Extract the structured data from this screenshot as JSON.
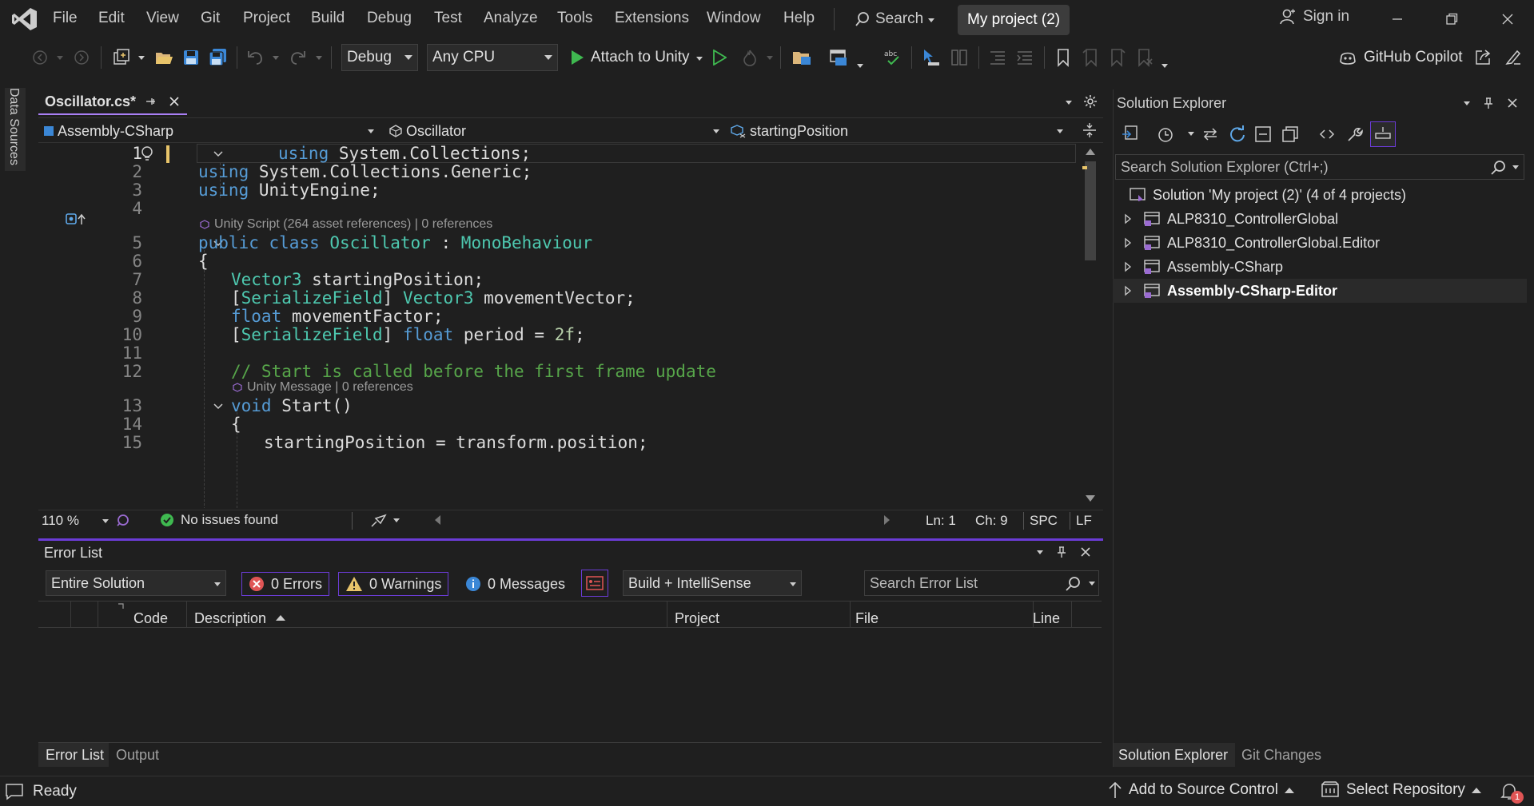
{
  "menu": {
    "items": [
      "File",
      "Edit",
      "View",
      "Git",
      "Project",
      "Build",
      "Debug",
      "Test",
      "Analyze",
      "Tools",
      "Extensions",
      "Window",
      "Help"
    ],
    "search_label": "Search",
    "project_name": "My project (2)",
    "sign_in": "Sign in"
  },
  "toolbar": {
    "config": "Debug",
    "platform": "Any CPU",
    "attach_label": "Attach to Unity",
    "copilot_label": "GitHub Copilot"
  },
  "left_strip": {
    "data_sources": "Data Sources"
  },
  "editor": {
    "tab_label": "Oscillator.cs*",
    "nav": {
      "project": "Assembly-CSharp",
      "type": "Oscillator",
      "member": "startingPosition"
    },
    "lines": [
      {
        "num": "1",
        "text": "using System.Collections;"
      },
      {
        "num": "2",
        "text": "using System.Collections.Generic;"
      },
      {
        "num": "3",
        "text": "using UnityEngine;"
      },
      {
        "num": "4",
        "text": ""
      },
      {
        "num": "5",
        "text": "public class Oscillator : MonoBehaviour"
      },
      {
        "num": "6",
        "text": "{"
      },
      {
        "num": "7",
        "text": "Vector3 startingPosition;"
      },
      {
        "num": "8",
        "text": "[SerializeField] Vector3 movementVector;"
      },
      {
        "num": "9",
        "text": "float movementFactor;"
      },
      {
        "num": "10",
        "text": "[SerializeField] float period = 2f;"
      },
      {
        "num": "11",
        "text": ""
      },
      {
        "num": "12",
        "text": "// Start is called before the first frame update"
      },
      {
        "num": "13",
        "text": "void Start()"
      },
      {
        "num": "14",
        "text": "{"
      },
      {
        "num": "15",
        "text": "startingPosition = transform.position;"
      }
    ],
    "codelens_class": "Unity Script (264 asset references) | 0 references",
    "codelens_start": "Unity Message | 0 references",
    "status": {
      "zoom": "110 %",
      "issues": "No issues found",
      "line": "Ln: 1",
      "col": "Ch: 9",
      "whitespace": "SPC",
      "eol": "LF"
    }
  },
  "error_list": {
    "title": "Error List",
    "scope": "Entire Solution",
    "errors": "0 Errors",
    "warnings": "0 Warnings",
    "messages": "0 Messages",
    "source": "Build + IntelliSense",
    "search_placeholder": "Search Error List",
    "columns": [
      "Code",
      "Description",
      "Project",
      "File",
      "Line"
    ],
    "tabs": [
      "Error List",
      "Output"
    ]
  },
  "solution_explorer": {
    "title": "Solution Explorer",
    "search_placeholder": "Search Solution Explorer (Ctrl+;)",
    "solution": "Solution 'My project (2)' (4 of 4 projects)",
    "projects": [
      "ALP8310_ControllerGlobal",
      "ALP8310_ControllerGlobal.Editor",
      "Assembly-CSharp",
      "Assembly-CSharp-Editor"
    ],
    "tabs": [
      "Solution Explorer",
      "Git Changes"
    ]
  },
  "statusbar": {
    "ready": "Ready",
    "source_control": "Add to Source Control",
    "repository": "Select Repository",
    "notifications": "1"
  },
  "colors": {
    "accent": "#6b3cd6",
    "keyword": "#569cd6",
    "type": "#4ec9b0",
    "comment": "#57a64a",
    "number": "#b5cea8",
    "run_green": "#3fb950"
  }
}
